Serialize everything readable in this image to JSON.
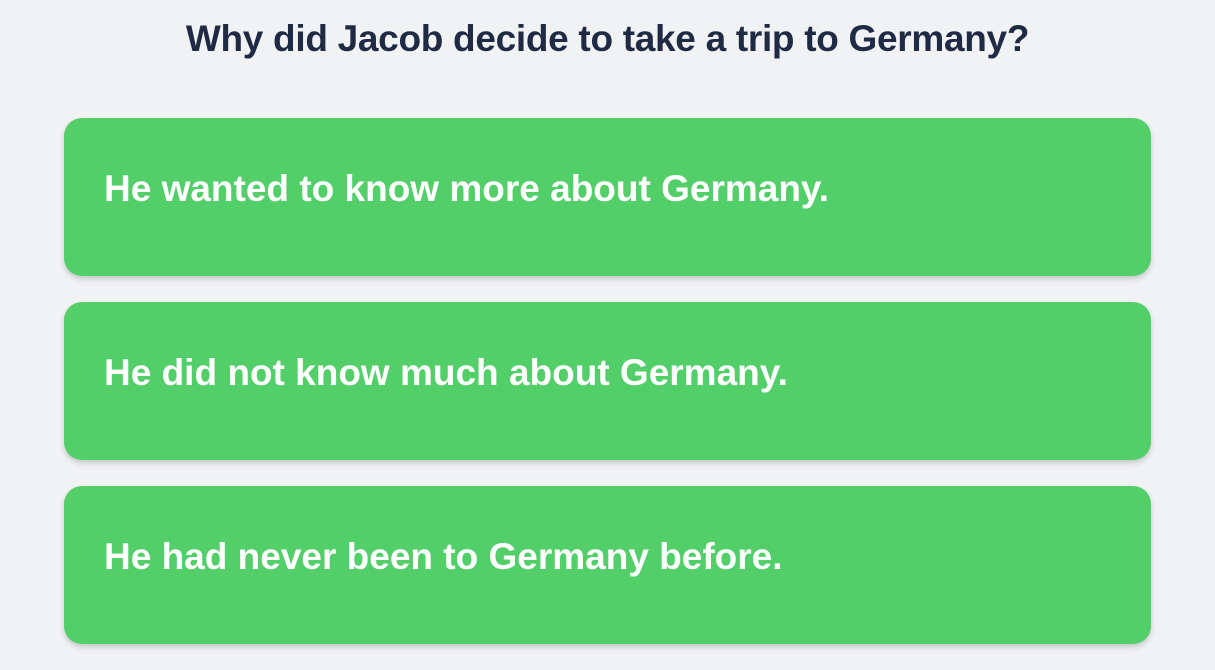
{
  "question": {
    "text": "Why did Jacob decide to take a trip to Germany?"
  },
  "options": [
    {
      "label": "He wanted to know more about Germany."
    },
    {
      "label": "He did not know much about Germany."
    },
    {
      "label": "He had never been to Germany before."
    }
  ],
  "colors": {
    "background": "#f1f2f4",
    "question_text": "#1f2a44",
    "option_background": "#52cf69",
    "option_text": "#ffffff"
  }
}
